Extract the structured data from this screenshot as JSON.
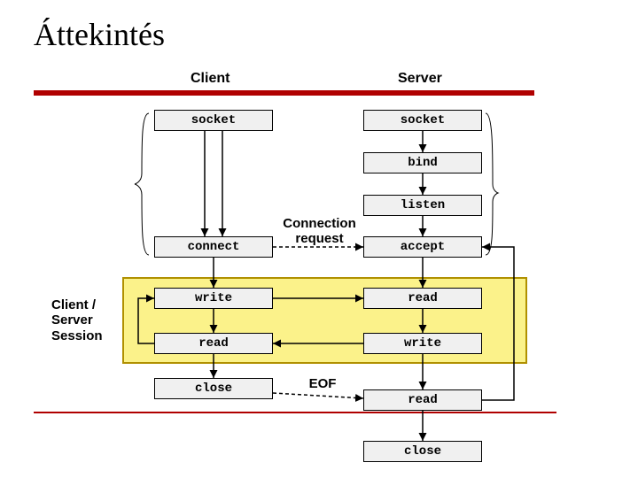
{
  "title": "Áttekintés",
  "columns": {
    "client": "Client",
    "server": "Server"
  },
  "client_boxes": {
    "socket": "socket",
    "connect": "connect",
    "write": "write",
    "read": "read",
    "close": "close"
  },
  "server_boxes": {
    "socket": "socket",
    "bind": "bind",
    "listen": "listen",
    "accept": "accept",
    "read": "read",
    "write": "write",
    "read2": "read",
    "close": "close"
  },
  "labels": {
    "connection_request_l1": "Connection",
    "connection_request_l2": "request",
    "eof": "EOF",
    "session_l1": "Client /",
    "session_l2": "Server",
    "session_l3": "Session"
  }
}
